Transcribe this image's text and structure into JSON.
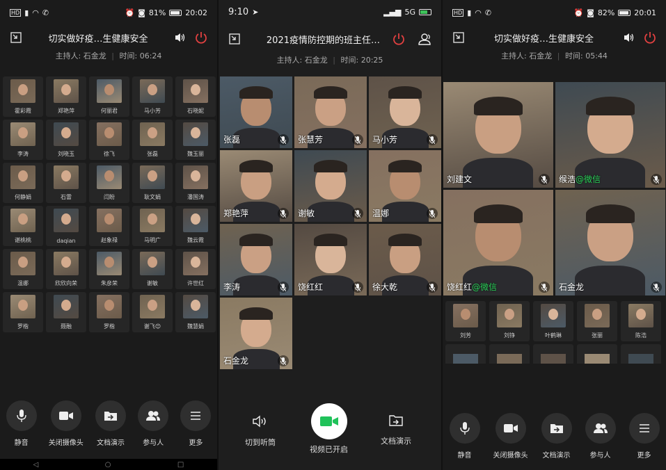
{
  "p1": {
    "status": {
      "time": "20:02",
      "battery": "81%"
    },
    "title": "切实做好疫…生健康安全",
    "host_label": "主持人:",
    "host": "石金龙",
    "time_label": "时间:",
    "duration": "06:24",
    "thumbs": [
      "霍彩霞",
      "郑艳萍",
      "何丽君",
      "马小芳",
      "石晓妮",
      "李涛",
      "刘晓玉",
      "徐飞",
      "张磊",
      "魏玉丽",
      "何静娟",
      "石雷",
      "闫盼",
      "耿文娟",
      "潘国涛",
      "谌桃桃",
      "daqian",
      "赵象禄",
      "马明广",
      "魏云霞",
      "温娜",
      "欣欣向荣",
      "朱彦荣",
      "谢敏",
      "许世红",
      "罗楷",
      "聂融",
      "罗楷",
      "谢飞😊",
      "魏慧娟"
    ],
    "buttons": [
      "静音",
      "关闭摄像头",
      "文档演示",
      "参与人",
      "更多"
    ]
  },
  "p2": {
    "status": {
      "time": "9:10",
      "network": "5G"
    },
    "title": "2021疫情防控期的班主任…",
    "host_label": "主持人:",
    "host": "石金龙",
    "time_label": "时间:",
    "duration": "20:25",
    "tiles": [
      "张磊",
      "张慧芳",
      "马小芳",
      "郑艳萍",
      "谢敏",
      "温娜",
      "李涛",
      "饶红红",
      "徐大乾",
      "石金龙"
    ],
    "buttons": {
      "audio": "切到听筒",
      "video": "视频已开启",
      "doc": "文档演示"
    }
  },
  "p3": {
    "status": {
      "time": "20:01",
      "battery": "82%"
    },
    "title": "切实做好疫…生健康安全",
    "host_label": "主持人:",
    "host": "石金龙",
    "time_label": "时间:",
    "duration": "05:44",
    "tiles": [
      {
        "name": "刘建文",
        "tag": ""
      },
      {
        "name": "缑浩",
        "tag": "@微信"
      },
      {
        "name": "饶红红",
        "tag": "@微信"
      },
      {
        "name": "石金龙",
        "tag": ""
      }
    ],
    "thumbs": [
      "刘芳",
      "刘铮",
      "叶鹤琳",
      "张丽",
      "陈浩"
    ],
    "buttons": [
      "静音",
      "关闭摄像头",
      "文档演示",
      "参与人",
      "更多"
    ]
  }
}
